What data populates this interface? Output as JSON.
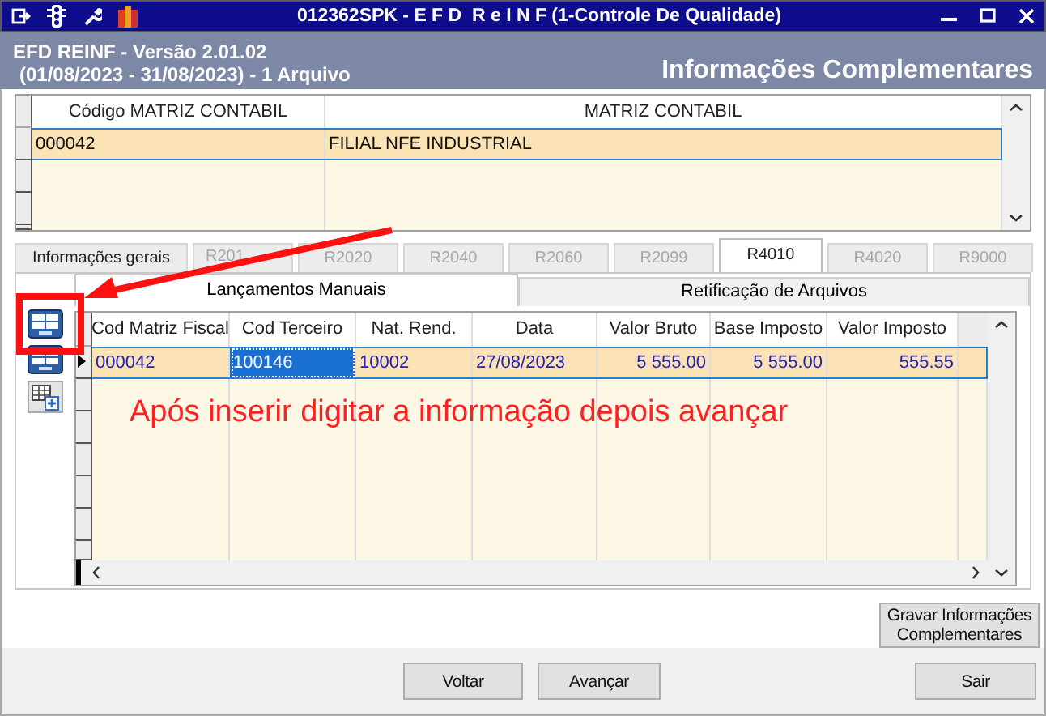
{
  "window": {
    "title": "012362SPK - E F D  R e I N F (1-Controle De Qualidade)"
  },
  "header": {
    "version": "EFD REINF - Versão 2.01.02",
    "period": "(01/08/2023 - 31/08/2023) - 1 Arquivo",
    "section": "Informações Complementares"
  },
  "top_grid": {
    "columns": [
      "Código MATRIZ CONTABIL",
      "MATRIZ CONTABIL"
    ],
    "rows": [
      {
        "selected": true,
        "cells": [
          {
            "text": "000042",
            "focused": false
          },
          {
            "text": "FILIAL NFE INDUSTRIAL",
            "focused": false
          }
        ]
      }
    ]
  },
  "tabs": [
    {
      "label": "Informações gerais",
      "selected": false,
      "disabled": false
    },
    {
      "label": "R201",
      "selected": false,
      "disabled": true
    },
    {
      "label": "R2020",
      "selected": false,
      "disabled": true
    },
    {
      "label": "R2040",
      "selected": false,
      "disabled": true
    },
    {
      "label": "R2060",
      "selected": false,
      "disabled": true
    },
    {
      "label": "R2099",
      "selected": false,
      "disabled": true
    },
    {
      "label": "R4010",
      "selected": true,
      "disabled": false
    },
    {
      "label": "R4020",
      "selected": false,
      "disabled": true
    },
    {
      "label": "R9000",
      "selected": false,
      "disabled": true
    }
  ],
  "subtabs": [
    {
      "label": "Lançamentos Manuais",
      "selected": true
    },
    {
      "label": "Retificação de Arquivos",
      "selected": false
    }
  ],
  "entries_grid": {
    "columns": [
      "Cod Matriz Fiscal",
      "Cod Terceiro",
      "Nat. Rend.",
      "Data",
      "Valor Bruto",
      "Base Imposto",
      "Valor Imposto"
    ],
    "rows": [
      {
        "selected": true,
        "cells": [
          {
            "text": "000042",
            "focused": false
          },
          {
            "text": "100146",
            "focused": true
          },
          {
            "text": "10002",
            "focused": false
          },
          {
            "text": "27/08/2023",
            "focused": false
          },
          {
            "text": "5 555.00",
            "focused": false
          },
          {
            "text": "5 555.00",
            "focused": false
          },
          {
            "text": "555.55",
            "focused": false
          }
        ]
      }
    ]
  },
  "annotation": {
    "text": "Após inserir digitar a informação depois avançar"
  },
  "save_button": {
    "label": "Gravar Informações Complementares"
  },
  "buttons": [
    {
      "label": "Voltar",
      "kind": "back"
    },
    {
      "label": "Avançar",
      "kind": "next"
    },
    {
      "label": "Sair",
      "kind": "exit"
    }
  ]
}
